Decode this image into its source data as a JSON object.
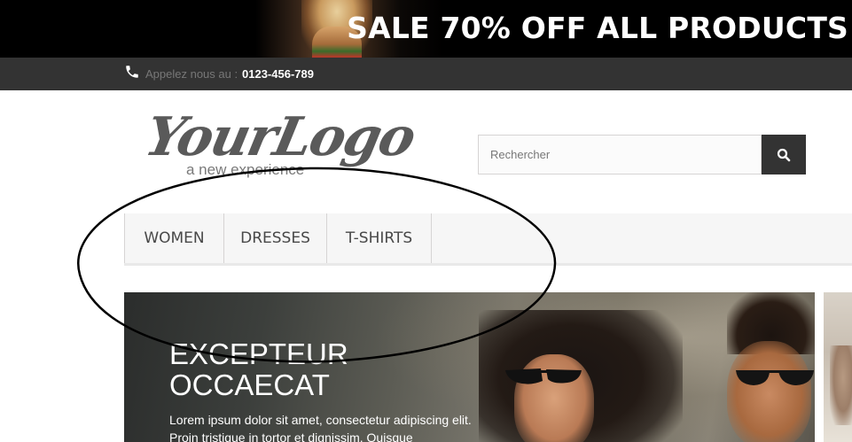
{
  "banner": {
    "text": "SALE 70% OFF ALL PRODUCTS"
  },
  "contact": {
    "label": "Appelez nous au :",
    "phone": "0123-456-789",
    "icon": "phone-icon"
  },
  "logo": {
    "main": "YourLogo",
    "sub": "a new experience"
  },
  "search": {
    "placeholder": "Rechercher",
    "icon": "search-icon"
  },
  "menu": {
    "items": [
      {
        "label": "WOMEN"
      },
      {
        "label": "DRESSES"
      },
      {
        "label": "T-SHIRTS"
      }
    ]
  },
  "slider": {
    "title_line1": "EXCEPTEUR",
    "title_line2": "OCCAECAT",
    "text": "Lorem ipsum dolor sit amet, consectetur adipiscing elit. Proin tristique in tortor et dignissim. Quisque"
  },
  "colors": {
    "dark_bar": "#333333",
    "menu_bg": "#f6f6f6",
    "text_dark": "#484848"
  }
}
